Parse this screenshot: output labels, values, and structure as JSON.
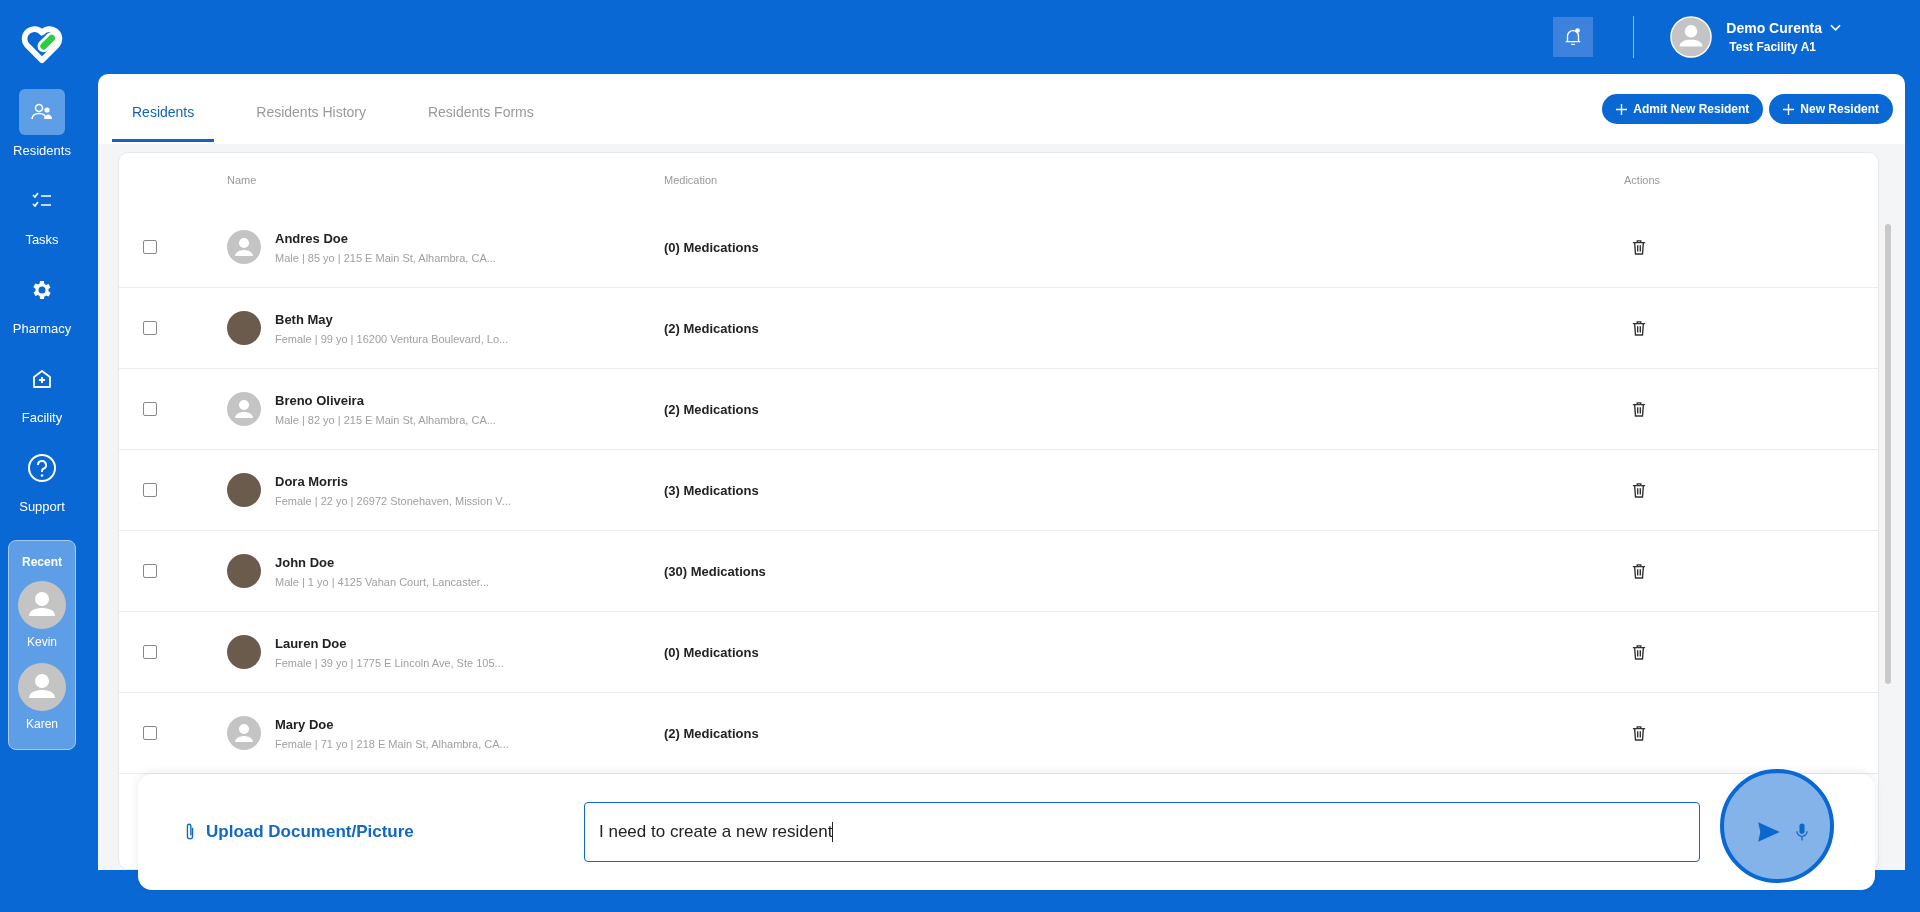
{
  "sidebar": {
    "items": [
      {
        "label": "Residents",
        "selected": true
      },
      {
        "label": "Tasks",
        "selected": false
      },
      {
        "label": "Pharmacy",
        "selected": false
      },
      {
        "label": "Facility",
        "selected": false
      },
      {
        "label": "Support",
        "selected": false
      }
    ],
    "recent": {
      "title": "Recent",
      "people": [
        {
          "name": "Kevin"
        },
        {
          "name": "Karen"
        }
      ]
    }
  },
  "header": {
    "user": {
      "name": "Demo Curenta",
      "facility": "Test Facility A1"
    }
  },
  "tabs": [
    {
      "label": "Residents",
      "selected": true
    },
    {
      "label": "Residents History",
      "selected": false
    },
    {
      "label": "Residents Forms",
      "selected": false
    }
  ],
  "buttons": [
    {
      "label": "Admit New Resident"
    },
    {
      "label": "New Resident"
    }
  ],
  "table": {
    "columns": [
      "Name",
      "Medication",
      "Actions"
    ],
    "rows": [
      {
        "checked": false,
        "kind": "default",
        "name": "Andres Doe",
        "details": "Male | 85 yo | 215 E Main St, Alhambra, CA...",
        "medication": "(0) Medications"
      },
      {
        "checked": false,
        "kind": "photo",
        "name": "Beth May",
        "details": "Female | 99 yo | 16200 Ventura Boulevard, Lo...",
        "medication": "(2) Medications"
      },
      {
        "checked": false,
        "kind": "default",
        "name": "Breno Oliveira",
        "details": "Male | 82 yo | 215 E Main St, Alhambra, CA...",
        "medication": "(2) Medications"
      },
      {
        "checked": false,
        "kind": "photo",
        "name": "Dora Morris",
        "details": "Female | 22 yo | 26972 Stonehaven, Mission V...",
        "medication": "(3) Medications"
      },
      {
        "checked": false,
        "kind": "photo",
        "name": "John Doe",
        "details": "Male | 1 yo | 4125 Vahan Court, Lancaster...",
        "medication": "(30) Medications"
      },
      {
        "checked": false,
        "kind": "photo",
        "name": "Lauren Doe",
        "details": "Female | 39 yo | 1775 E Lincoln Ave, Ste 105...",
        "medication": "(0) Medications"
      },
      {
        "checked": false,
        "kind": "default",
        "name": "Mary Doe",
        "details": "Female | 71 yo | 218 E Main St, Alhambra, CA...",
        "medication": "(2) Medications"
      }
    ]
  },
  "composer": {
    "upload_label": "Upload Document/Picture",
    "message": "I need to create a new resident"
  }
}
